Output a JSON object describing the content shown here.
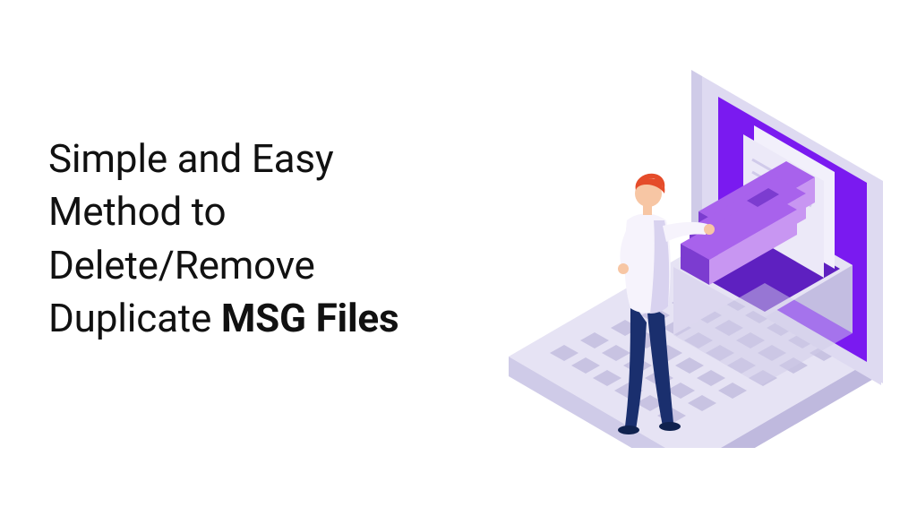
{
  "headline": {
    "line1": "Simple and Easy",
    "line2": "Method to",
    "line3": "Delete/Remove",
    "line4_pre": "Duplicate ",
    "line4_bold": "MSG Files"
  },
  "illustration": {
    "name": "isometric-laptop-files-illustration",
    "colors": {
      "laptop_base_top": "#E6E3F4",
      "laptop_base_side": "#CFCBE8",
      "keyboard_keys": "#C8C3E2",
      "screen_outer": "#DEDAF1",
      "screen_inner": "#7A1AF0",
      "file_box": "#DCD7EF",
      "file_box_side": "#C3BDE1",
      "file_purple_light": "#C896F2",
      "file_purple_mid": "#A862EC",
      "file_purple_dark": "#7C3CD0",
      "paper_light": "#F2F0FB",
      "paper_line": "#D0CAEA",
      "person_hair": "#E54C2A",
      "person_skin": "#F7C6A4",
      "person_shirt": "#F6F3FC",
      "person_pants": "#1A2F6E",
      "person_shirt_shade": "#D8D2EF"
    }
  }
}
